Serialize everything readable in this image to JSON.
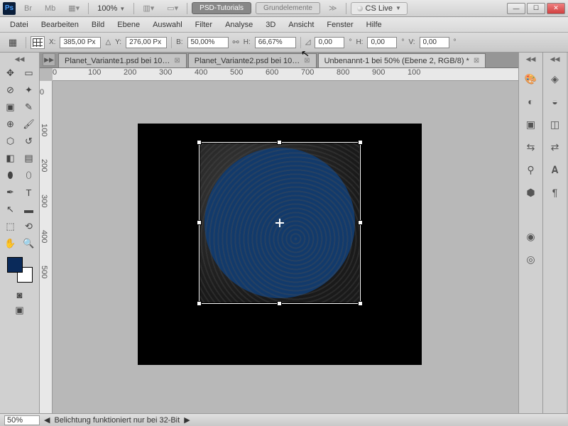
{
  "title": {
    "ps": "Ps",
    "br": "Br",
    "mb": "Mb",
    "zoom": "100%",
    "psd": "PSD-Tutorials",
    "grund": "Grundelemente",
    "cs": "CS Live"
  },
  "menu": [
    "Datei",
    "Bearbeiten",
    "Bild",
    "Ebene",
    "Auswahl",
    "Filter",
    "Analyse",
    "3D",
    "Ansicht",
    "Fenster",
    "Hilfe"
  ],
  "opt": {
    "x_lbl": "X:",
    "x": "385,00 Px",
    "y_lbl": "Y:",
    "y": "276,00 Px",
    "w_lbl": "B:",
    "w": "50,00%",
    "h_lbl": "H:",
    "h": "66,67%",
    "ang_lbl": "△",
    "ang": "0,00",
    "deg": "°",
    "h2_lbl": "H:",
    "h2": "0,00",
    "v_lbl": "V:",
    "v": "0,00"
  },
  "tabs": [
    {
      "label": "Planet_Variante1.psd bei 10…"
    },
    {
      "label": "Planet_Variante2.psd bei 10…"
    },
    {
      "label": "Unbenannt-1 bei 50% (Ebene 2, RGB/8) *"
    }
  ],
  "ruler_h": [
    "0",
    "100",
    "200",
    "300",
    "400",
    "500",
    "600",
    "700",
    "800",
    "900",
    "100"
  ],
  "ruler_v": [
    "0",
    "100",
    "200",
    "300",
    "400",
    "500"
  ],
  "tools": [
    "move",
    "marquee",
    "lasso",
    "wand",
    "crop",
    "eyedrop",
    "heal",
    "brush",
    "stamp",
    "history",
    "eraser",
    "gradient",
    "blur",
    "dodge",
    "pen",
    "type",
    "path",
    "shape",
    "hand",
    "3d",
    "rotate",
    "zoom"
  ],
  "panels_left": [
    "palette",
    "channels",
    "adjust",
    "swatch",
    "paths",
    "mask",
    "ruler"
  ],
  "panels_right": [
    "layers",
    "clone",
    "char",
    "history",
    "circle"
  ],
  "status": {
    "zoom": "50%",
    "msg": "Belichtung funktioniert nur bei 32-Bit"
  }
}
